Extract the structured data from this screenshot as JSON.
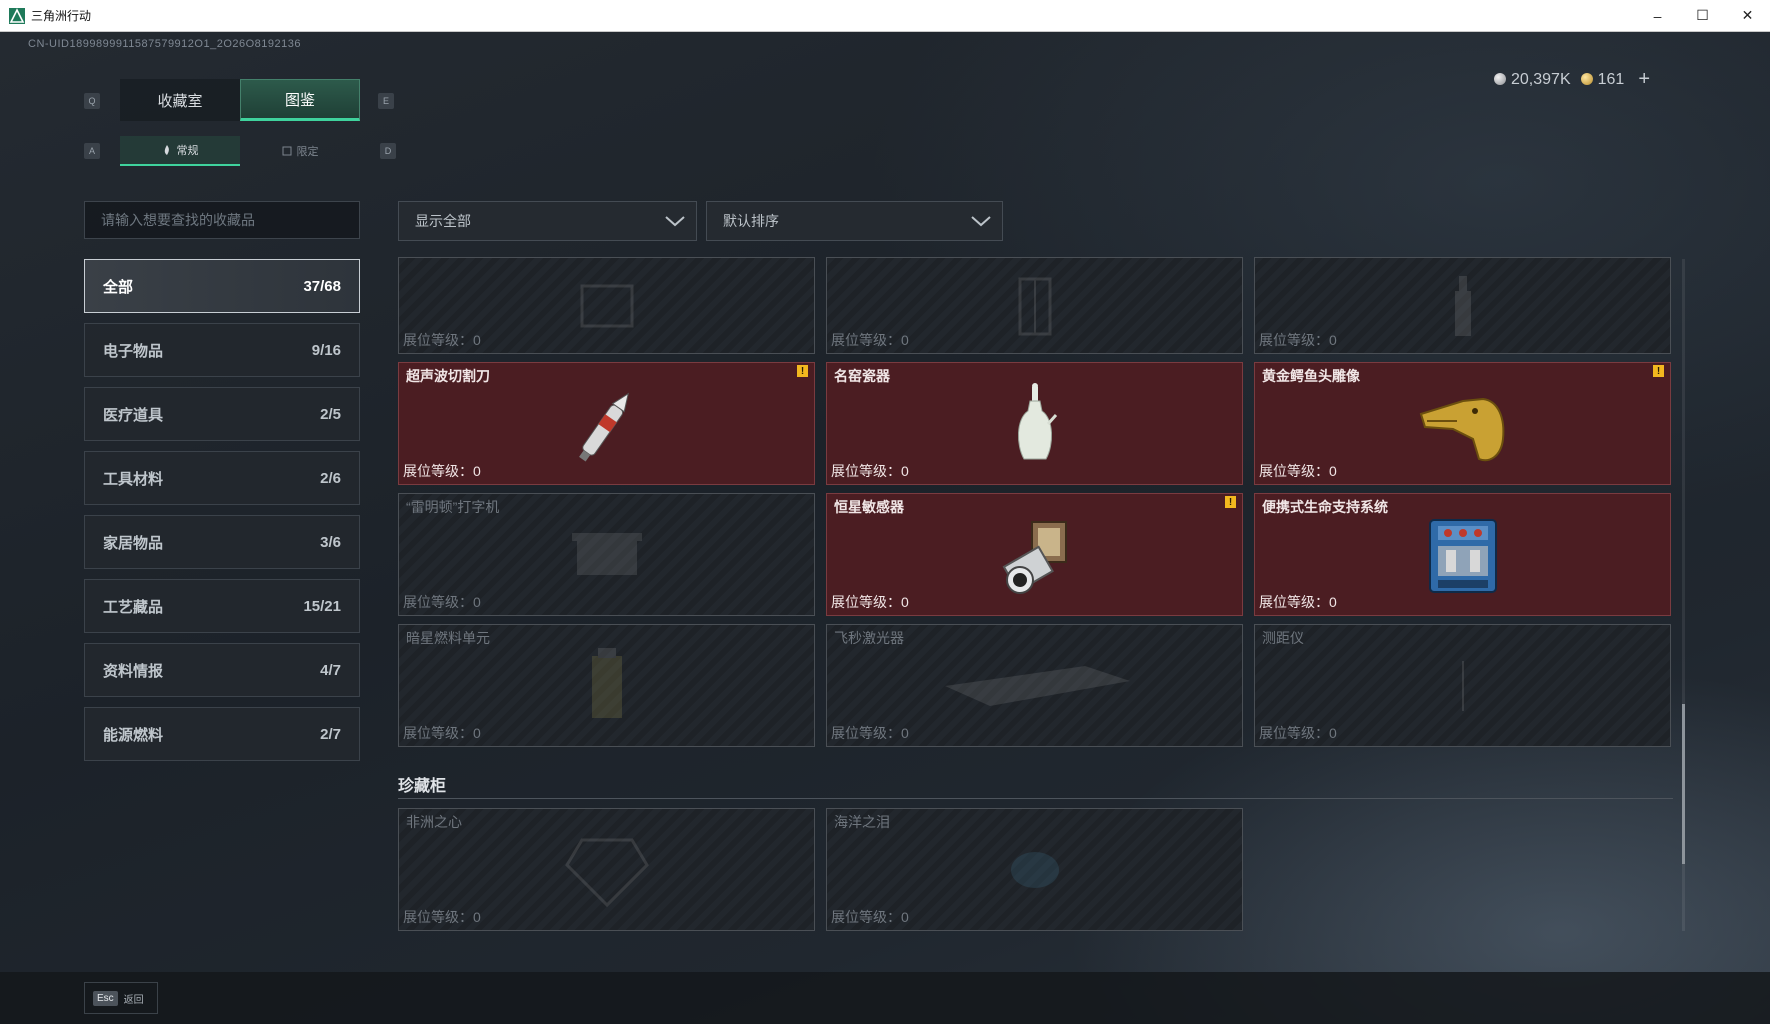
{
  "window": {
    "title": "三角洲行动",
    "minimize": "–",
    "maximize": "☐",
    "close": "✕"
  },
  "uid": "CN-UID1899899911587579912O1_2O26O8192136",
  "currency": {
    "silver": "20,397K",
    "gold": "161",
    "add": "+"
  },
  "keys": {
    "q": "Q",
    "e": "E",
    "a": "A",
    "d": "D"
  },
  "tabs": [
    {
      "label": "收藏室"
    },
    {
      "label": "图鉴"
    }
  ],
  "subtabs": [
    {
      "label": "常规"
    },
    {
      "label": "限定"
    }
  ],
  "search": {
    "placeholder": "请输入想要查找的收藏品"
  },
  "categories": [
    {
      "label": "全部",
      "count": "37/68"
    },
    {
      "label": "电子物品",
      "count": "9/16"
    },
    {
      "label": "医疗道具",
      "count": "2/5"
    },
    {
      "label": "工具材料",
      "count": "2/6"
    },
    {
      "label": "家居物品",
      "count": "3/6"
    },
    {
      "label": "工艺藏品",
      "count": "15/21"
    },
    {
      "label": "资料情报",
      "count": "4/7"
    },
    {
      "label": "能源燃料",
      "count": "2/7"
    }
  ],
  "filters": {
    "show": "显示全部",
    "sort": "默认排序"
  },
  "items": [
    {
      "name": "",
      "level": "展位等级：0",
      "owned": false,
      "icon": "generic-item-icon"
    },
    {
      "name": "",
      "level": "展位等级：0",
      "owned": false,
      "icon": "lantern-icon"
    },
    {
      "name": "",
      "level": "展位等级：0",
      "owned": false,
      "icon": "bottle-icon"
    },
    {
      "name": "超声波切割刀",
      "level": "展位等级：0",
      "owned": true,
      "warn": "!",
      "icon": "ultrasonic-knife-icon"
    },
    {
      "name": "名窑瓷器",
      "level": "展位等级：0",
      "owned": true,
      "icon": "porcelain-vase-icon"
    },
    {
      "name": "黄金鳄鱼头雕像",
      "level": "展位等级：0",
      "owned": true,
      "warn": "!",
      "icon": "gold-crocodile-head-icon"
    },
    {
      "name": "“雷明顿”打字机",
      "level": "展位等级：0",
      "owned": false,
      "icon": "typewriter-icon"
    },
    {
      "name": "恒星敏感器",
      "level": "展位等级：0",
      "owned": true,
      "warn": "!",
      "icon": "star-sensor-icon"
    },
    {
      "name": "便携式生命支持系统",
      "level": "展位等级：0",
      "owned": true,
      "icon": "life-support-system-icon"
    },
    {
      "name": "暗星燃料单元",
      "level": "展位等级：0",
      "owned": false,
      "icon": "fuel-cell-icon"
    },
    {
      "name": "飞秒激光器",
      "level": "展位等级：0",
      "owned": false,
      "icon": "femtosecond-laser-icon"
    },
    {
      "name": "测距仪",
      "level": "展位等级：0",
      "owned": false,
      "icon": "rangefinder-icon"
    }
  ],
  "treasure": {
    "title": "珍藏柜",
    "items": [
      {
        "name": "非洲之心",
        "level": "展位等级：0",
        "owned": false,
        "icon": "diamond-icon"
      },
      {
        "name": "海洋之泪",
        "level": "展位等级：0",
        "owned": false,
        "icon": "gem-icon"
      }
    ]
  },
  "back": {
    "key": "Esc",
    "label": "返回"
  },
  "colors": {
    "accent": "#3fd39d",
    "owned_bg": "#4b1d22",
    "warn": "#f2b81f"
  }
}
